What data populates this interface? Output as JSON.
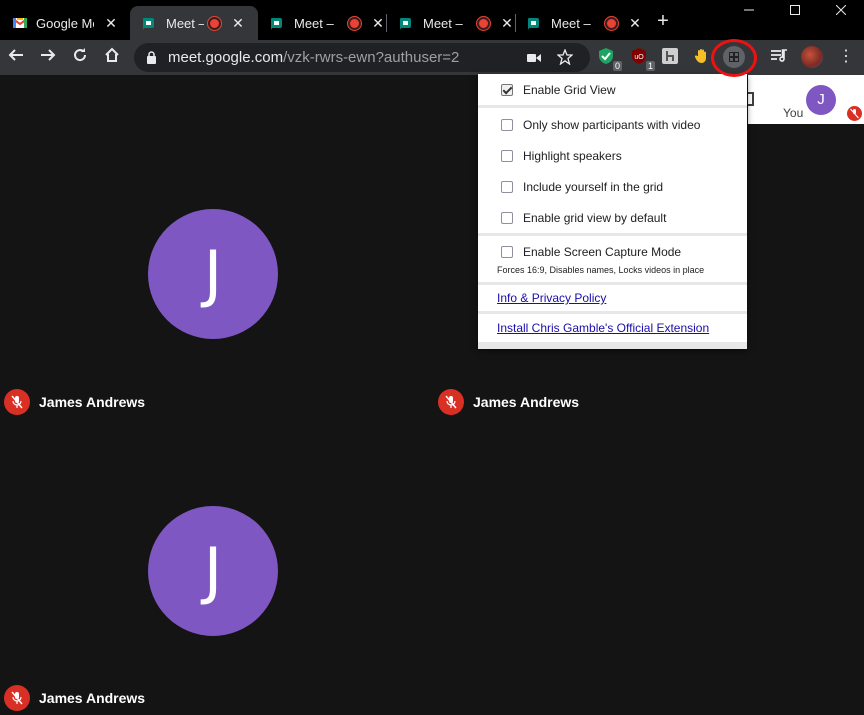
{
  "tabs": [
    {
      "title": "Google Meet",
      "favicon": "google-meet-logo-icon",
      "active": false
    },
    {
      "title": "Meet – vzk-rwrs-ewn",
      "favicon": "meet-icon",
      "active": true
    },
    {
      "title": "Meet – ",
      "favicon": "meet-icon",
      "active": false
    },
    {
      "title": "Meet – ",
      "favicon": "meet-icon",
      "active": false
    },
    {
      "title": "Meet – ",
      "favicon": "meet-icon",
      "active": false
    }
  ],
  "omnibox": {
    "host": "meet.google.com",
    "path": "/vzk-rwrs-ewn?authuser=2"
  },
  "extensions": [
    {
      "name": "shield-check-extension-icon",
      "badge": "0"
    },
    {
      "name": "ublock-extension-icon",
      "badge": "1"
    },
    {
      "name": "dark-extension-icon",
      "badge": ""
    },
    {
      "name": "raise-hand-extension-icon",
      "badge": ""
    }
  ],
  "grid_popup": {
    "sections": [
      {
        "options": [
          {
            "label": "Enable Grid View",
            "checked": true
          }
        ]
      },
      {
        "options": [
          {
            "label": "Only show participants with video",
            "checked": false
          },
          {
            "label": "Highlight speakers",
            "checked": false
          },
          {
            "label": "Include yourself in the grid",
            "checked": false
          },
          {
            "label": "Enable grid view by default",
            "checked": false
          }
        ]
      },
      {
        "options": [
          {
            "label": "Enable Screen Capture Mode",
            "checked": false
          }
        ],
        "note": "Forces 16:9, Disables names, Locks videos in place"
      }
    ],
    "links": [
      "Info & Privacy Policy",
      "Install Chris Gamble's Official Extension"
    ]
  },
  "participants": [
    {
      "initial": "J",
      "name": "James Andrews",
      "muted": true
    },
    {
      "initial": "",
      "name": "James Andrews",
      "muted": true
    },
    {
      "initial": "J",
      "name": "James Andrews",
      "muted": true
    }
  ],
  "self_view": {
    "label": "You",
    "initial": "J",
    "muted": true
  },
  "colors": {
    "avatar": "#7e57c2",
    "mic_off": "#d93025",
    "highlight_ring": "#ee1111"
  }
}
